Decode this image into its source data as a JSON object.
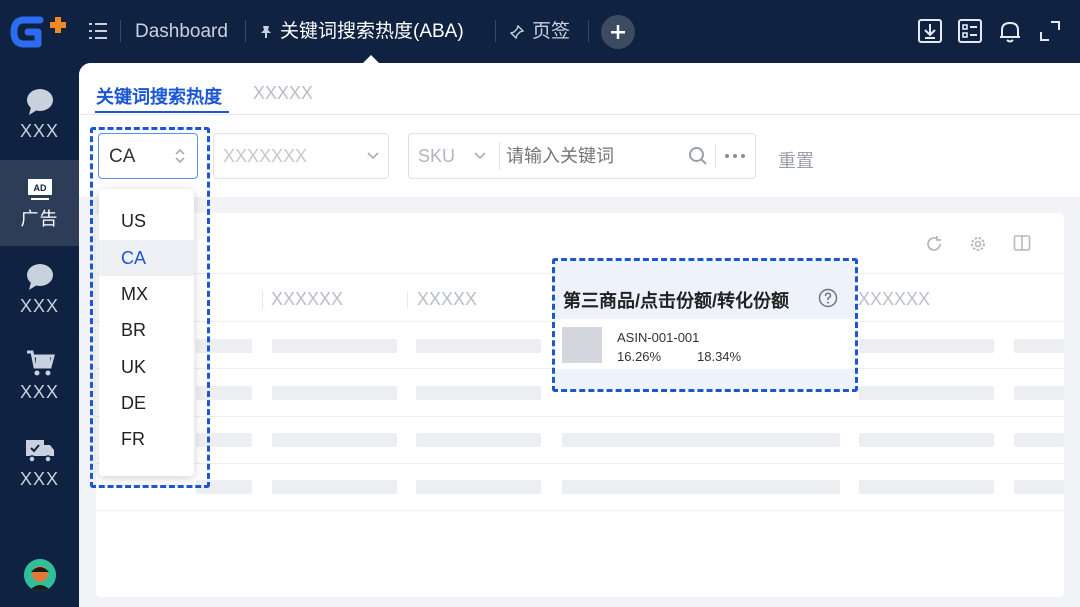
{
  "topbar": {
    "breadcrumb_home": "Dashboard",
    "active_tab": "关键词搜索热度(ABA)",
    "pinned_tab": "页签"
  },
  "sidebar": {
    "items": [
      {
        "label": "XXX",
        "icon": "chat-bubble-icon"
      },
      {
        "label": "广告",
        "icon": "ad-icon",
        "badge": "AD"
      },
      {
        "label": "XXX",
        "icon": "chat-bubble-icon"
      },
      {
        "label": "XXX",
        "icon": "shopping-cart-icon"
      },
      {
        "label": "XXX",
        "icon": "delivery-truck-icon"
      }
    ]
  },
  "page_tabs": [
    {
      "label": "关键词搜索热度",
      "active": true
    },
    {
      "label": "XXXXX",
      "active": false
    }
  ],
  "filters": {
    "marketplace_value": "CA",
    "second_placeholder": "XXXXXXX",
    "sku_label": "SKU",
    "keyword_placeholder": "请输入关键词",
    "reset_label": "重置"
  },
  "marketplace_options": [
    "US",
    "CA",
    "MX",
    "BR",
    "UK",
    "DE",
    "FR"
  ],
  "marketplace_selected": "CA",
  "table": {
    "columns": [
      "XXXXXX",
      "XXXXX",
      "XXXXXX"
    ]
  },
  "popover": {
    "title": "第三商品/点击份额/转化份额",
    "asin": "ASIN-001-001",
    "click_share": "16.26%",
    "conversion_share": "18.34%"
  },
  "colors": {
    "nav_bg": "#0f2241",
    "accent": "#1a56d6",
    "logo_blue": "#2b6cf0",
    "logo_orange": "#f08a24"
  }
}
